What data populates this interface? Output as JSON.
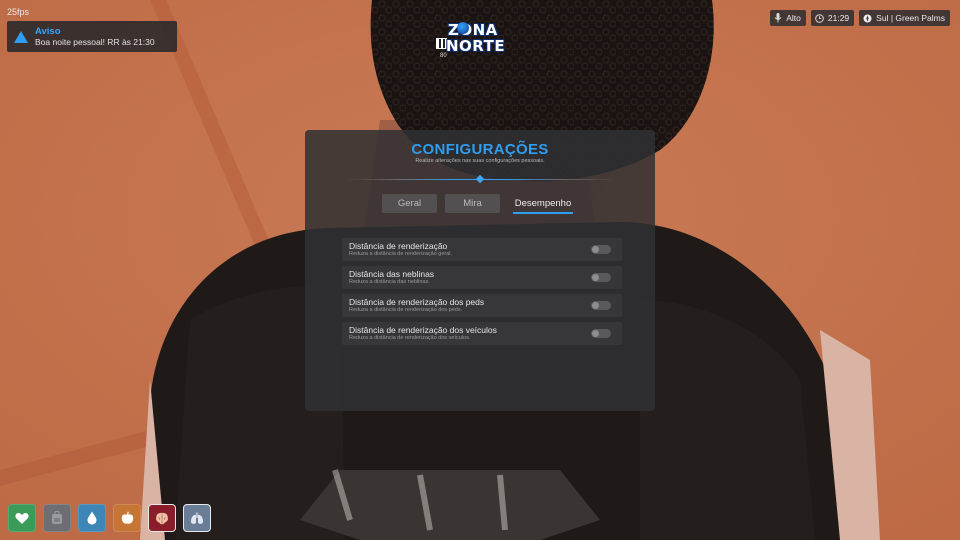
{
  "fps": "25fps",
  "notification": {
    "title": "Aviso",
    "message": "Boa noite pessoal! RR às 21:30"
  },
  "logo": {
    "line1": "ZONA",
    "line2": "NORTE",
    "sub": "80"
  },
  "hud": {
    "voice": "Alto",
    "time": "21:29",
    "location": "Sul | Green Palms"
  },
  "settings": {
    "title": "CONFIGURAÇÕES",
    "subtitle": "Realize alterações nas suas configurações pessoais.",
    "tabs": [
      {
        "label": "Geral"
      },
      {
        "label": "Mira"
      },
      {
        "label": "Desempenho"
      }
    ],
    "active_tab": "Desempenho",
    "options": [
      {
        "label": "Distância de renderização",
        "desc": "Reduza a distância de renderização geral.",
        "enabled": false
      },
      {
        "label": "Distância das neblinas",
        "desc": "Reduza a distância das neblinas.",
        "enabled": false
      },
      {
        "label": "Distância de renderização dos peds",
        "desc": "Reduza a distância de renderização dos peds.",
        "enabled": false
      },
      {
        "label": "Distância de renderização dos veículos",
        "desc": "Reduza a distância de renderização dos veículos.",
        "enabled": false
      }
    ]
  },
  "status_icons": [
    "heart-icon",
    "backpack-icon",
    "drop-icon",
    "apple-icon",
    "brain-icon",
    "lungs-icon"
  ],
  "colors": {
    "accent": "#2f9df0",
    "health": "#3b9c5a",
    "water": "#3e86b8",
    "food": "#c67534",
    "stress": "#8a1d2a"
  }
}
